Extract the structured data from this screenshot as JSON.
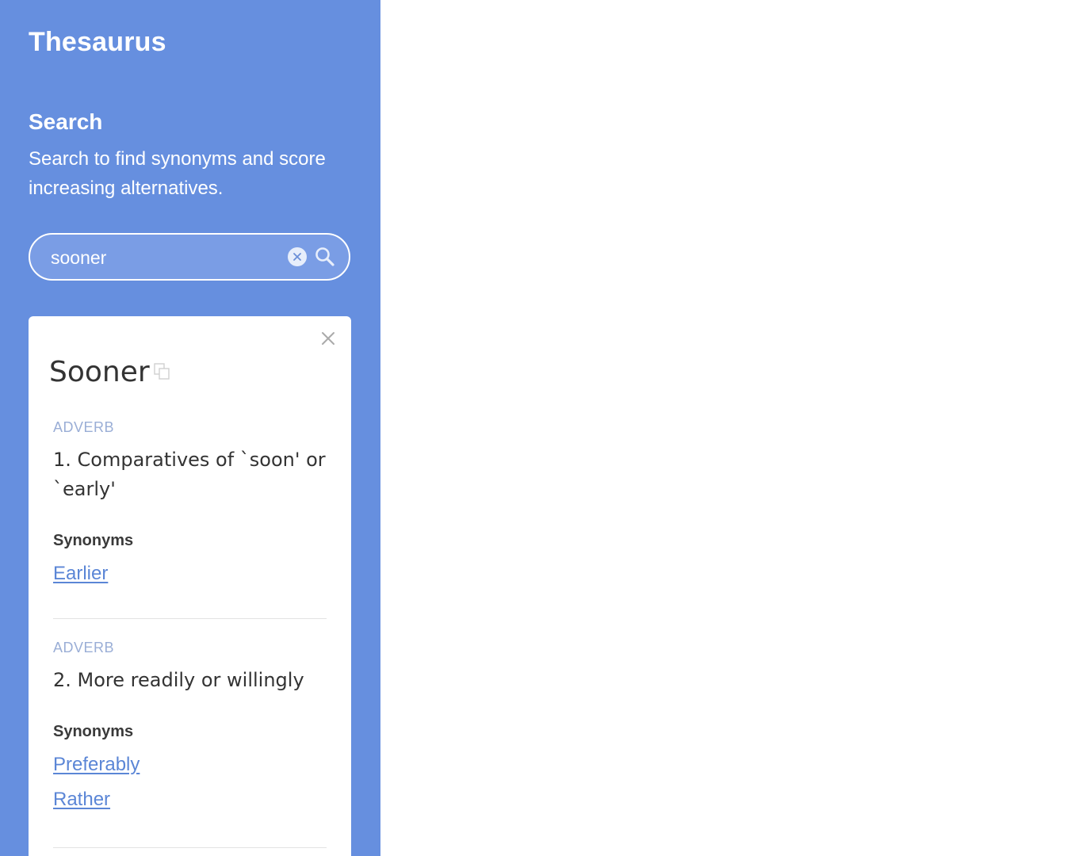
{
  "app": {
    "title": "Thesaurus"
  },
  "search_section": {
    "title": "Search",
    "description": "Search to find synonyms and score increasing alternatives."
  },
  "search": {
    "value": "sooner"
  },
  "card": {
    "word": "Sooner",
    "senses": [
      {
        "part_of_speech": "ADVERB",
        "definition": "1. Comparatives of `soon' or `early'",
        "synonyms_heading": "Synonyms",
        "synonyms": [
          "Earlier"
        ]
      },
      {
        "part_of_speech": "ADVERB",
        "definition": "2. More readily or willingly",
        "synonyms_heading": "Synonyms",
        "synonyms": [
          "Preferably",
          "Rather"
        ]
      }
    ]
  },
  "colors": {
    "sidebar_bg": "#668fdf",
    "link": "#5b86d6",
    "pos_label": "#9aaed6"
  },
  "icons": [
    "clear-icon",
    "search-icon",
    "close-icon",
    "copy-icon"
  ]
}
